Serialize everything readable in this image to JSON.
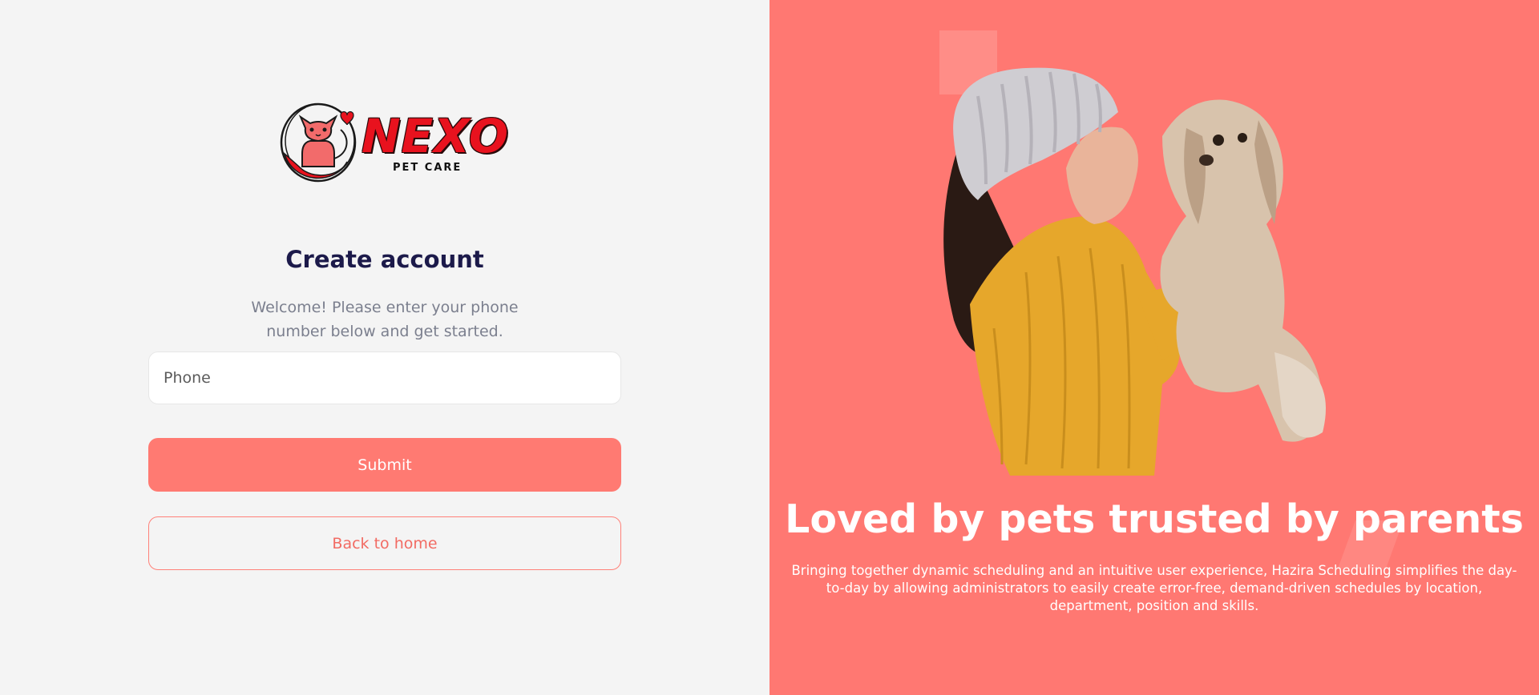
{
  "logo": {
    "wordmark": "NEXO",
    "tagline": "PET CARE",
    "icon": "cat-in-circle-logo-icon",
    "brand_red": "#e8121e"
  },
  "form": {
    "title": "Create account",
    "subtitle": "Welcome! Please enter your phone number below and get started.",
    "phone_placeholder": "Phone",
    "phone_value": "",
    "submit_label": "Submit",
    "back_label": "Back to home"
  },
  "hero": {
    "heading": "Loved by pets trusted by parents",
    "body": "Bringing together dynamic scheduling and an intuitive user experience, Hazira Scheduling simplifies the day-to-day by allowing administrators to easily create error-free, demand-driven schedules by location, department, position and skills.",
    "image": "woman-kissing-dog-photo"
  },
  "colors": {
    "accent": "#ff7872",
    "left_background": "#f4f4f4",
    "title_navy": "#1c1a4a",
    "muted_text": "#7b7f8e"
  }
}
